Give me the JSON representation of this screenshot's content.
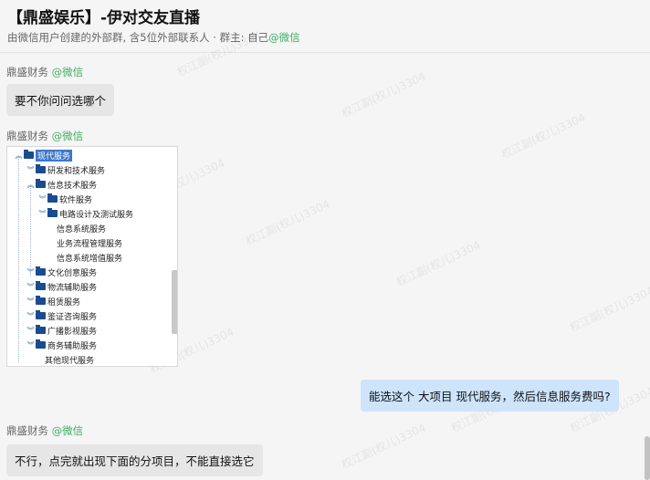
{
  "header": {
    "title": "【鼎盛娱乐】-伊对交友直播",
    "subtitle": "由微信用户创建的外部群, 含5位外部联系人 · 群主: 自己",
    "subtitle_wechat": "@微信"
  },
  "messages": [
    {
      "sender": "鼎盛财务",
      "tag": "@微信",
      "text": "要不你问问选哪个"
    },
    {
      "sender": "鼎盛财务",
      "tag": "@微信"
    },
    {
      "text": "能选这个 大项目  现代服务，然后信息服务费吗?"
    },
    {
      "sender": "鼎盛财务",
      "tag": "@微信",
      "text": "不行，点完就出现下面的分项目，不能直接选它"
    }
  ],
  "tree": [
    {
      "label": "现代服务",
      "level": 0,
      "type": "folder",
      "expanded": true,
      "selected": true
    },
    {
      "label": "研发和技术服务",
      "level": 1,
      "type": "folder",
      "expanded": false
    },
    {
      "label": "信息技术服务",
      "level": 1,
      "type": "folder",
      "expanded": true
    },
    {
      "label": "软件服务",
      "level": 2,
      "type": "folder",
      "expanded": false
    },
    {
      "label": "电路设计及测试服务",
      "level": 2,
      "type": "folder",
      "expanded": false
    },
    {
      "label": "信息系统服务",
      "level": 2,
      "type": "leaf"
    },
    {
      "label": "业务流程管理服务",
      "level": 2,
      "type": "leaf"
    },
    {
      "label": "信息系统增值服务",
      "level": 2,
      "type": "leaf"
    },
    {
      "label": "文化创意服务",
      "level": 1,
      "type": "folder",
      "expanded": false
    },
    {
      "label": "物流辅助服务",
      "level": 1,
      "type": "folder",
      "expanded": false
    },
    {
      "label": "租赁服务",
      "level": 1,
      "type": "folder",
      "expanded": false
    },
    {
      "label": "鉴证咨询服务",
      "level": 1,
      "type": "folder",
      "expanded": false
    },
    {
      "label": "广播影视服务",
      "level": 1,
      "type": "folder",
      "expanded": false
    },
    {
      "label": "商务辅助服务",
      "level": 1,
      "type": "folder",
      "expanded": false
    },
    {
      "label": "其他现代服务",
      "level": 1,
      "type": "leaf"
    }
  ],
  "watermark": "权江副(权儿)3304",
  "colors": {
    "wechat_green": "#3dae63",
    "my_bubble": "#cde4fb",
    "other_bubble": "#e6e6e6",
    "tree_folder": "#1b4b8f",
    "tree_selection": "#3d78c9"
  }
}
